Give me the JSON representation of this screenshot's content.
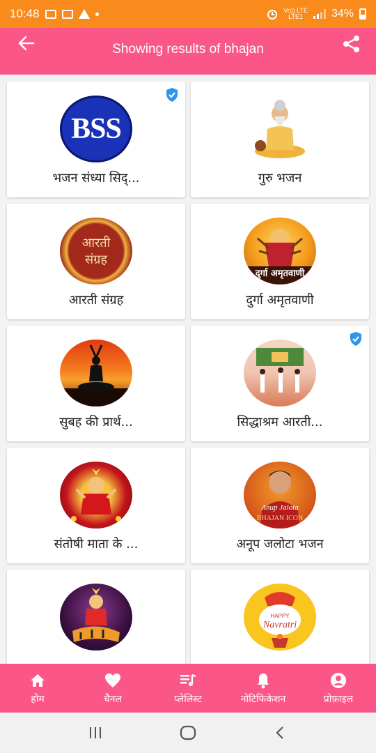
{
  "status_bar": {
    "time": "10:48",
    "carrier_line1": "Vo)) LTE",
    "carrier_line2": "LTE1",
    "battery": "34%"
  },
  "app_bar": {
    "title": "Showing results of bhajan",
    "back_icon": "arrow-left-icon",
    "share_icon": "share-icon"
  },
  "cards": [
    {
      "label": "भजन संध्या सिद्...",
      "verified": true
    },
    {
      "label": "गुरु भजन",
      "verified": false
    },
    {
      "label": "आरती संग्रह",
      "verified": false
    },
    {
      "label": "दुर्गा अमृतवाणी",
      "verified": false
    },
    {
      "label": "सुबह की प्रार्थ...",
      "verified": true
    },
    {
      "label": "सिद्धाश्रम आरती...",
      "verified": true
    },
    {
      "label": "संतोषी माता के ...",
      "verified": false
    },
    {
      "label": "अनूप जलोटा भजन",
      "verified": false
    },
    {
      "label": "",
      "verified": false
    },
    {
      "label": "",
      "verified": false
    }
  ],
  "thumbs": {
    "bss_text": "BSS",
    "aarti_text1": "आरती",
    "aarti_text2": "संग्रह",
    "durga_text": "दुर्गा अमृतवाणी",
    "anup_text1": "Anup Jalota",
    "anup_text2": "BHAJAN ICON",
    "navratri_text1": "HAPPY",
    "navratri_text2": "Navratri"
  },
  "bottom_nav": [
    {
      "label": "होम",
      "icon": "home-icon"
    },
    {
      "label": "चैनल",
      "icon": "heart-icon"
    },
    {
      "label": "प्लेलिस्ट",
      "icon": "playlist-icon"
    },
    {
      "label": "नोटिफिकेशन",
      "icon": "bell-icon"
    },
    {
      "label": "प्रोफ़ाइल",
      "icon": "profile-icon"
    }
  ],
  "colors": {
    "status_bar": "#f98a1c",
    "primary": "#fb5688",
    "verified": "#2f95e8"
  }
}
